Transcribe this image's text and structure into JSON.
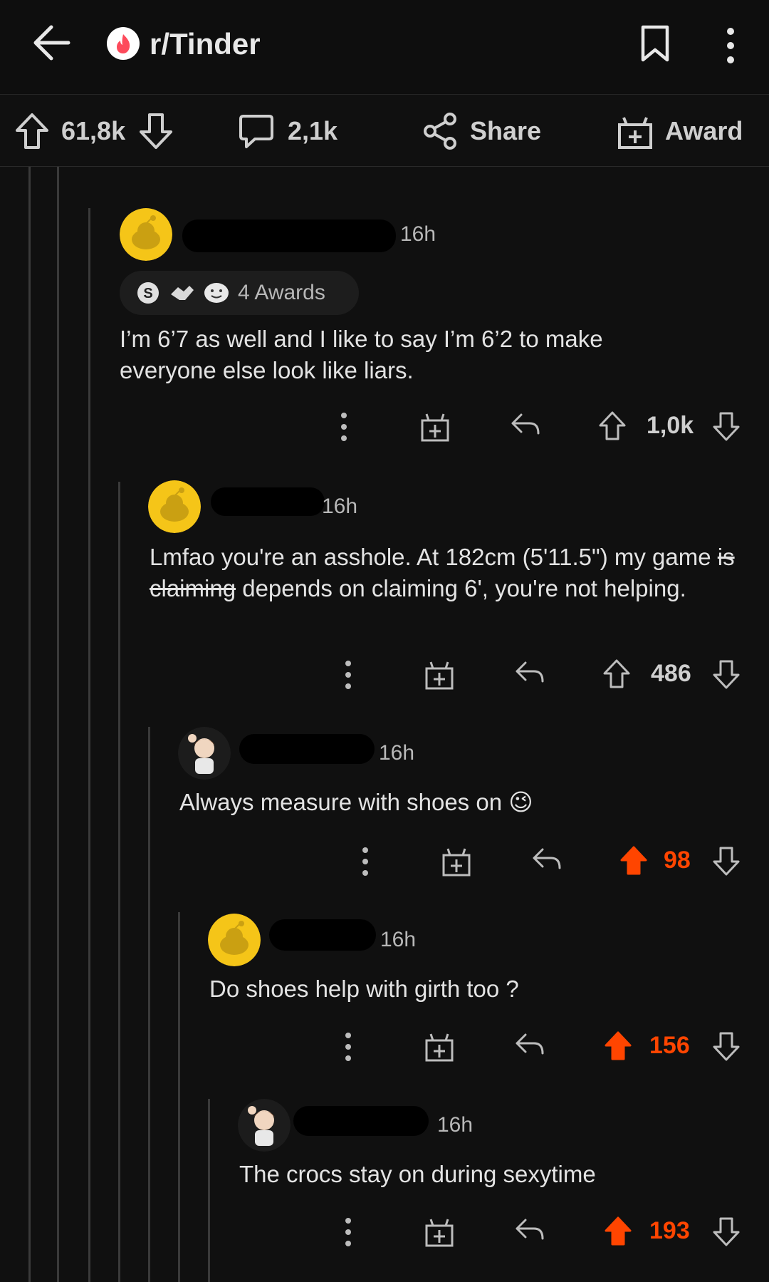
{
  "header": {
    "subreddit": "r/Tinder",
    "icons": [
      "back-arrow-icon",
      "tinder-logo-icon",
      "bookmark-icon",
      "more-vertical-icon"
    ]
  },
  "action_bar": {
    "upvotes": "61,8k",
    "comments": "2,1k",
    "share_label": "Share",
    "award_label": "Award"
  },
  "comments": [
    {
      "time": "16h",
      "awards_label": "4 Awards",
      "text": "I’m 6’7 as well and I like to say I’m 6’2 to make everyone else look like liars.",
      "score": "1,0k",
      "upvoted": false
    },
    {
      "time": "16h",
      "text_before": "Lmfao you're an asshole. At 182cm (5'11.5\") my game ",
      "text_strike": "is claiming",
      "text_after": " depends on claiming 6', you're not helping.",
      "score": "486",
      "upvoted": false
    },
    {
      "time": "16h",
      "text": "Always measure with shoes on 😉",
      "score": "98",
      "upvoted": true
    },
    {
      "time": "16h",
      "text": "Do shoes help with girth too ?",
      "score": "156",
      "upvoted": true
    },
    {
      "time": "16h",
      "text": "The crocs stay on during sexytime",
      "score": "193",
      "upvoted": true
    }
  ],
  "colors": {
    "background": "#101010",
    "upvote_active": "#ff4500",
    "text": "#e3e3e3",
    "muted": "#b8b8b8",
    "snoo_yellow": "#f5c518"
  }
}
